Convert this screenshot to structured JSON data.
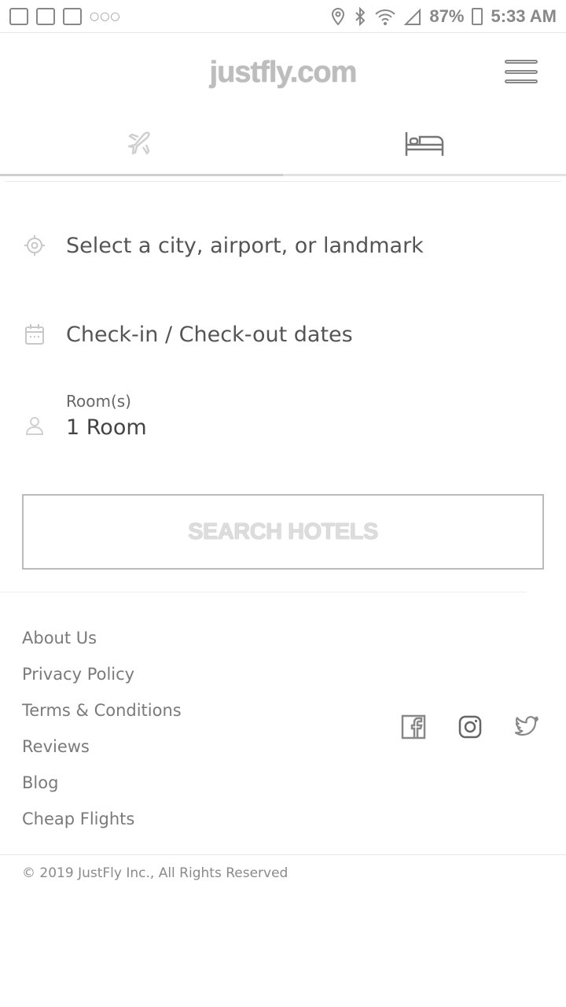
{
  "status_bar": {
    "battery": "87%",
    "time": "5:33 AM",
    "left_icons": [
      "photo-notification-icon",
      "check-notification-icon",
      "mail-notification-icon",
      "more-notifications-icon"
    ],
    "right_icons": [
      "location-icon",
      "bluetooth-icon",
      "wifi-icon",
      "signal-icon",
      "battery-icon"
    ]
  },
  "header": {
    "logo": "justfly.com",
    "menu_icon": "hamburger-menu-icon"
  },
  "tabs": [
    {
      "id": "flights",
      "icon": "airplane-icon"
    },
    {
      "id": "hotels",
      "icon": "bed-icon"
    }
  ],
  "form": {
    "location_placeholder": "Select a city, airport, or landmark",
    "dates_placeholder": "Check-in / Check-out dates",
    "rooms_label": "Room(s)",
    "rooms_value": "1 Room",
    "search_button": "SEARCH HOTELS"
  },
  "footer": {
    "links": [
      "About Us",
      "Privacy Policy",
      "Terms & Conditions",
      "Reviews",
      "Blog",
      "Cheap Flights"
    ],
    "social": [
      "facebook-icon",
      "instagram-icon",
      "twitter-icon"
    ],
    "copyright": "© 2019 JustFly Inc., All Rights Reserved"
  },
  "colors": {
    "text": "#555555",
    "muted": "#8a8a8a",
    "border": "#bbbbbb",
    "background": "#ffffff"
  }
}
